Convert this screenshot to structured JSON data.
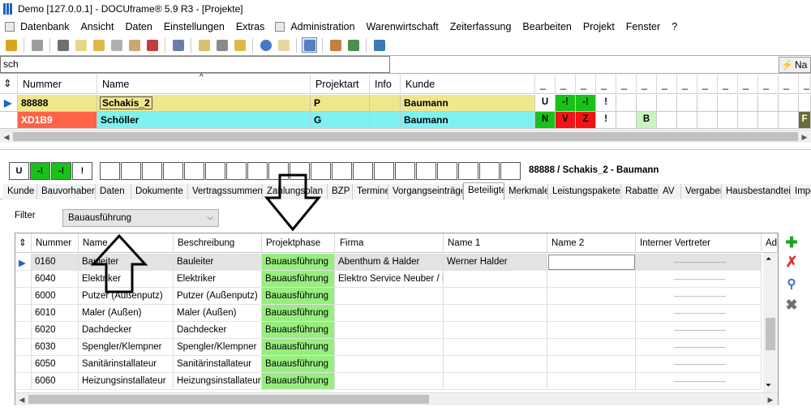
{
  "window": {
    "title": "Demo [127.0.0.1] - DOCUframe® 5.9 R3 - [Projekte]"
  },
  "menu": [
    "Datenbank",
    "Ansicht",
    "Daten",
    "Einstellungen",
    "Extras",
    "Administration",
    "Warenwirtschaft",
    "Zeiterfassung",
    "Bearbeiten",
    "Projekt",
    "Fenster",
    "?"
  ],
  "search": {
    "value": "sch",
    "right_button": "Na"
  },
  "topgrid": {
    "headers": {
      "nummer": "Nummer",
      "name": "Name",
      "projektart": "Projektart",
      "info": "Info",
      "kunde": "Kunde",
      "dash": "_"
    },
    "rows": [
      {
        "nummer": "88888",
        "name": "Schakis_2",
        "projektart": "P",
        "info": "",
        "kunde": "Baumann",
        "s1": "U",
        "s2": "-!",
        "s3": "-!",
        "s4": "!",
        "s5": "",
        "s6": "",
        "s7": ""
      },
      {
        "nummer": "XD1B9",
        "name": "Schöller",
        "projektart": "G",
        "info": "",
        "kunde": "Baumann",
        "s1": "N",
        "s2": "V",
        "s3": "Z",
        "s4": "!",
        "s5": "",
        "s6": "B",
        "s7": "F"
      }
    ],
    "colors": {
      "row1": "#f0e68c",
      "row2": "#7ef2f2",
      "row2_nummer": "#ff6347",
      "green": "#19c219",
      "red": "#f01414",
      "lightgreen": "#c8f5c0"
    }
  },
  "statusboxes": [
    "U",
    "-!",
    "-!",
    "!",
    "",
    "",
    "",
    "",
    "",
    "",
    "",
    "",
    "",
    "",
    "",
    "",
    "",
    "",
    "",
    "",
    "",
    "",
    "",
    "",
    ""
  ],
  "project_info": "88888 / Schakis_2 - Baumann",
  "tabs": [
    "Kunde",
    "Bauvorhaben",
    "Daten",
    "Dokumente",
    "Vertragssummen",
    "Zahlungsplan",
    "BZP",
    "Termine",
    "Vorgangseinträge",
    "Beteiligte",
    "Merkmale",
    "Leistungspakete",
    "Rabatte",
    "AV",
    "Vergaben",
    "Hausbestandteile",
    "Impo"
  ],
  "active_tab": "Beteiligte",
  "filter": {
    "label": "Filter",
    "value": "Bauausführung"
  },
  "lowergrid": {
    "headers": {
      "nummer": "Nummer",
      "name": "Name",
      "beschreibung": "Beschreibung",
      "projektphase": "Projektphase",
      "firma": "Firma",
      "name1": "Name 1",
      "name2": "Name 2",
      "vertreter": "Interner Vertreter",
      "ad": "Ad"
    },
    "rows": [
      {
        "nummer": "0160",
        "name": "Bauleiter",
        "beschreibung": "Bauleiter",
        "projektphase": "Bauausführung",
        "firma": "Abenthum & Halder",
        "name1": "Werner Halder",
        "name2": "",
        "vertreter": "————————"
      },
      {
        "nummer": "6040",
        "name": "Elektriker",
        "beschreibung": "Elektriker",
        "projektphase": "Bauausführung",
        "firma": "Elektro Service Neuber / El",
        "name1": "",
        "name2": "",
        "vertreter": "————————"
      },
      {
        "nummer": "6000",
        "name": "Putzer (Außenputz)",
        "beschreibung": "Putzer (Außenputz)",
        "projektphase": "Bauausführung",
        "firma": "",
        "name1": "",
        "name2": "",
        "vertreter": "————————"
      },
      {
        "nummer": "6010",
        "name": "Maler (Außen)",
        "beschreibung": "Maler (Außen)",
        "projektphase": "Bauausführung",
        "firma": "",
        "name1": "",
        "name2": "",
        "vertreter": "————————"
      },
      {
        "nummer": "6020",
        "name": "Dachdecker",
        "beschreibung": "Dachdecker",
        "projektphase": "Bauausführung",
        "firma": "",
        "name1": "",
        "name2": "",
        "vertreter": "————————"
      },
      {
        "nummer": "6030",
        "name": "Spengler/Klempner",
        "beschreibung": "Spengler/Klempner",
        "projektphase": "Bauausführung",
        "firma": "",
        "name1": "",
        "name2": "",
        "vertreter": "————————"
      },
      {
        "nummer": "6050",
        "name": "Sanitärinstallateur",
        "beschreibung": "Sanitärinstallateur",
        "projektphase": "Bauausführung",
        "firma": "",
        "name1": "",
        "name2": "",
        "vertreter": "————————"
      },
      {
        "nummer": "6060",
        "name": "Heizungsinstallateur",
        "beschreibung": "Heizungsinstallateur",
        "projektphase": "Bauausführung",
        "firma": "",
        "name1": "",
        "name2": "",
        "vertreter": "————————"
      }
    ]
  },
  "side_icons": [
    "add-icon",
    "delete-icon",
    "search-icon",
    "remove-icon"
  ]
}
